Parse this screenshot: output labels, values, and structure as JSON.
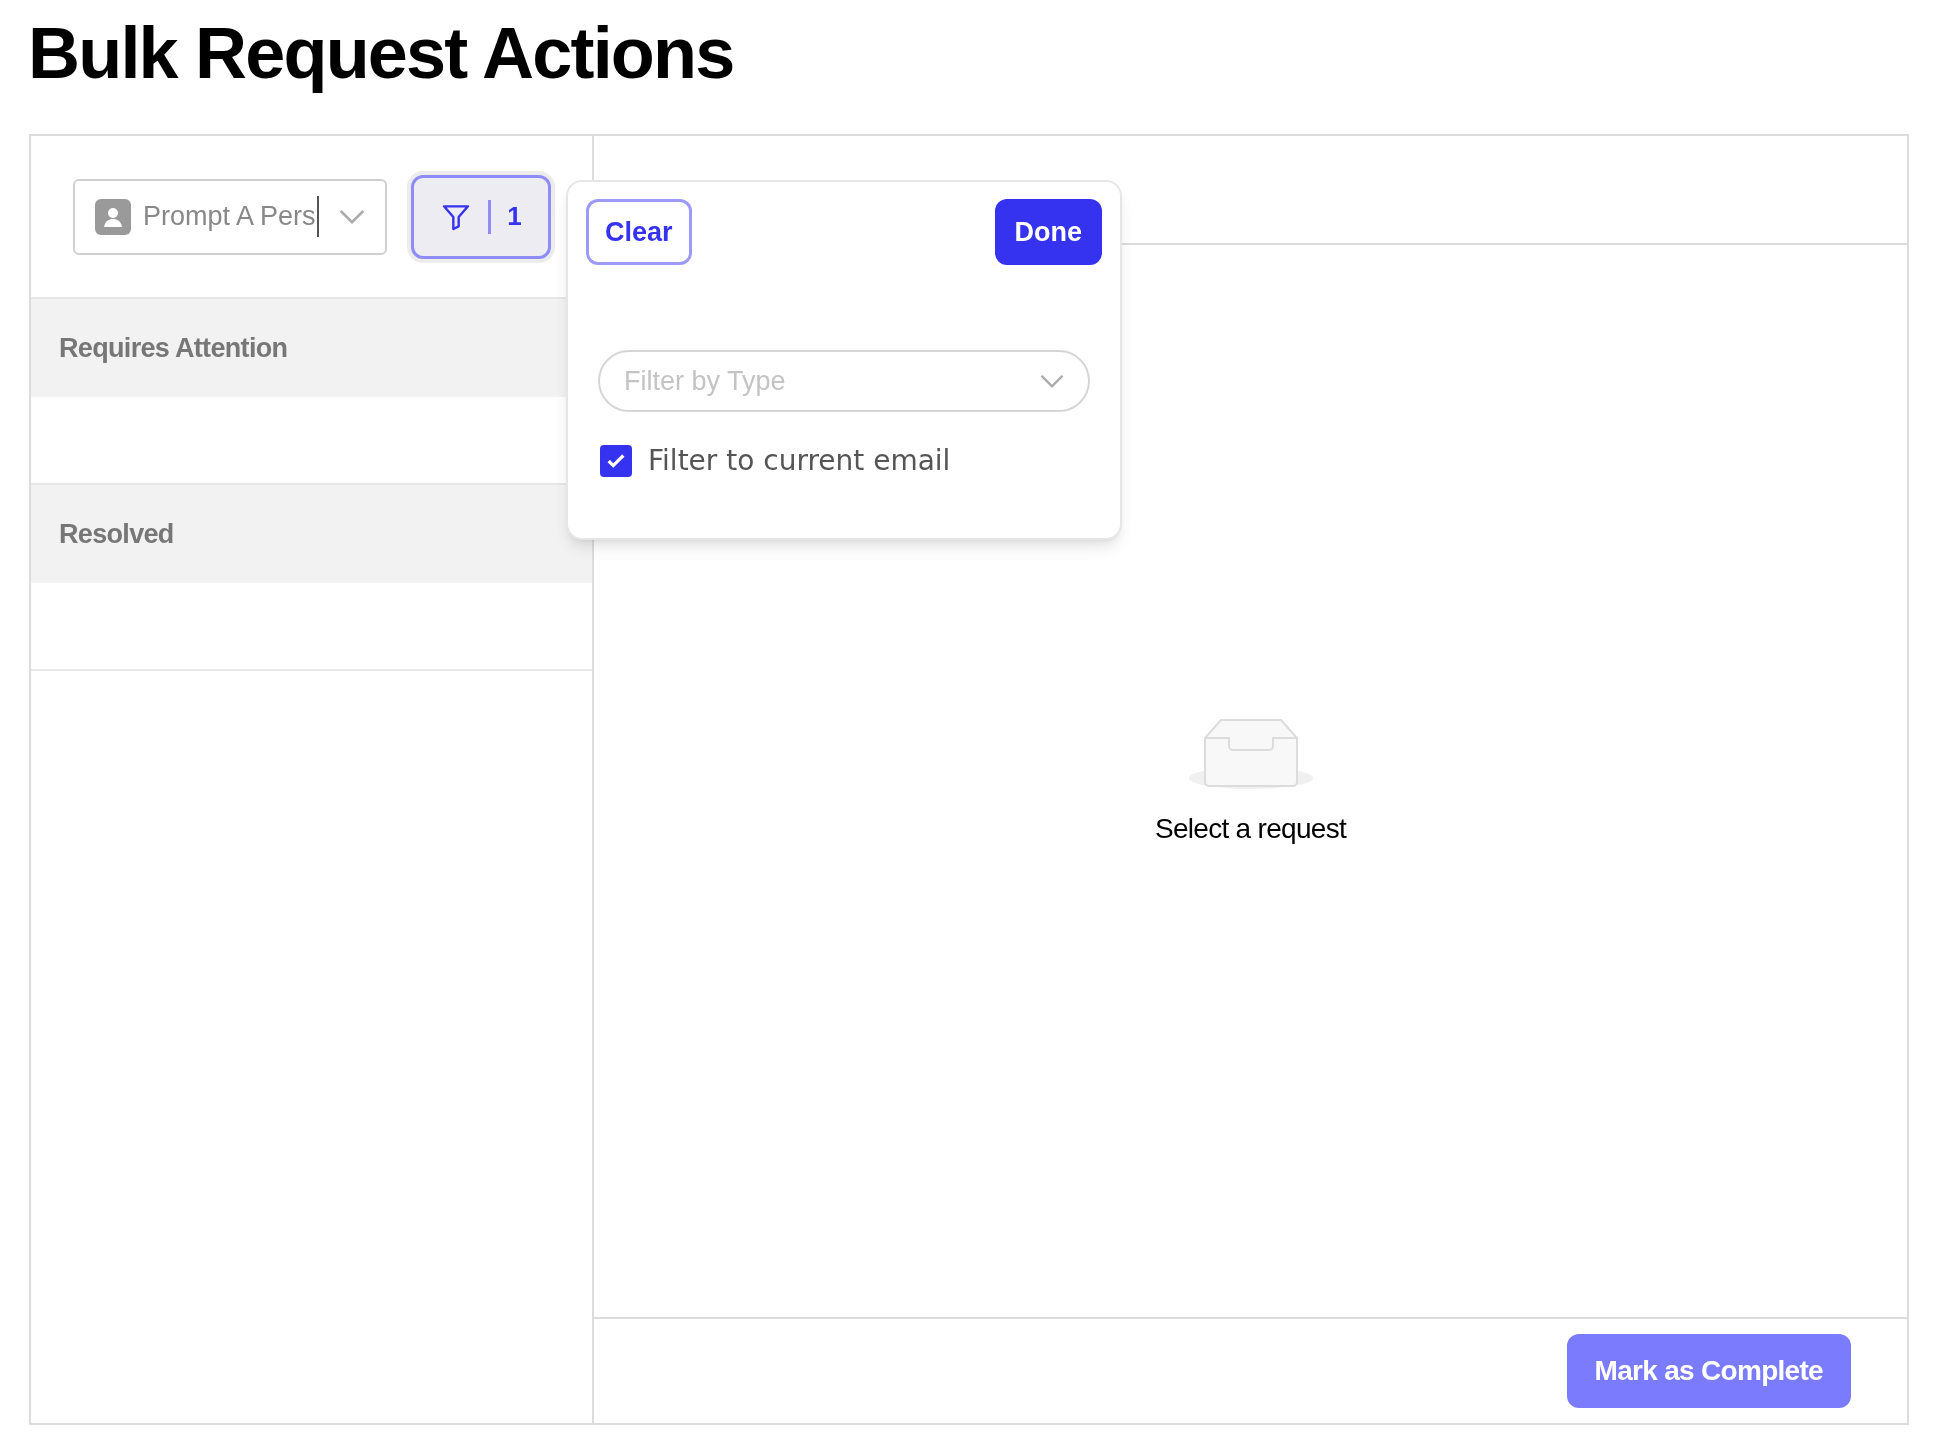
{
  "page_title": "Bulk Request Actions",
  "persona_select": {
    "value": "Prompt A Pers"
  },
  "filter_button": {
    "count": "1",
    "active": true
  },
  "sections": [
    {
      "title": "Requires Attention"
    },
    {
      "title": "Resolved"
    }
  ],
  "filter_popover": {
    "clear_label": "Clear",
    "done_label": "Done",
    "type_select": {
      "placeholder": "Filter by Type"
    },
    "checkbox": {
      "label": "Filter to current email",
      "checked": true
    }
  },
  "empty_state": {
    "text": "Select a request"
  },
  "complete_button": {
    "label": "Mark as Complete",
    "disabled": true
  }
}
